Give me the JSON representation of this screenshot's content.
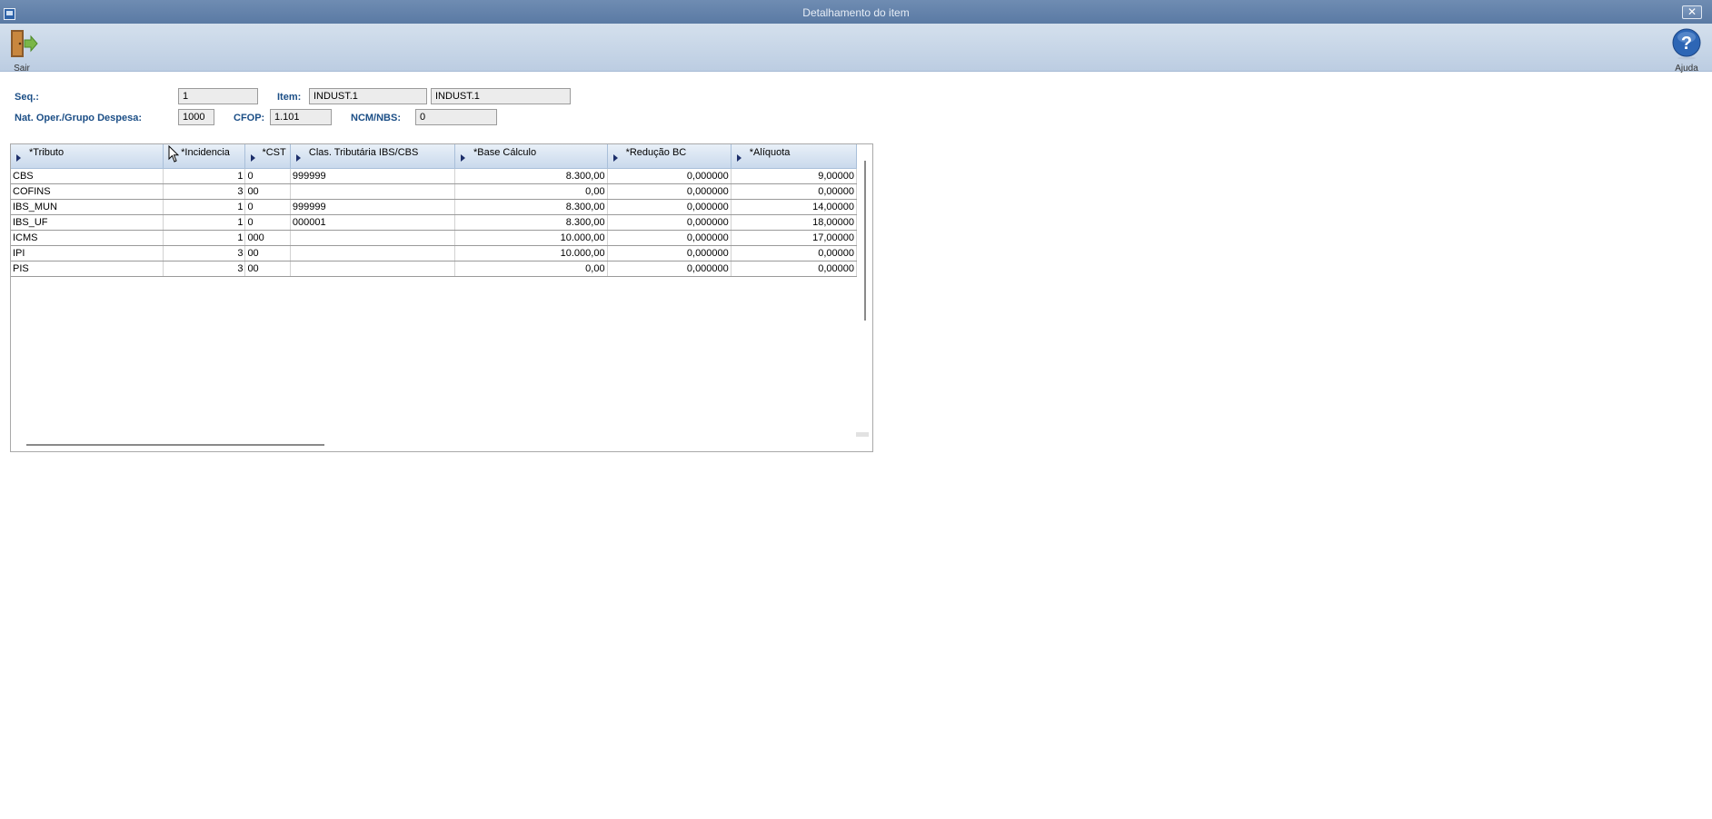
{
  "window": {
    "title": "Detalhamento do item",
    "close_icon": "close-icon"
  },
  "toolbar": {
    "exit": {
      "label": "Sair",
      "icon": "exit-door-icon"
    },
    "help": {
      "label": "Ajuda",
      "icon": "help-icon"
    }
  },
  "form": {
    "seq_label": "Seq.:",
    "seq_value": "1",
    "item_label": "Item:",
    "item_code": "INDUST.1",
    "item_description": "INDUST.1",
    "nat_oper_label": "Nat. Oper./Grupo Despesa:",
    "nat_oper_value": "1000",
    "cfop_label": "CFOP:",
    "cfop_value": "1.101",
    "ncm_label": "NCM/NBS:",
    "ncm_value": "0"
  },
  "grid": {
    "columns": [
      "*Tributo",
      "*Incidencia",
      "*CST",
      "Clas. Tributária IBS/CBS",
      "*Base Cálculo",
      "*Redução BC",
      "*Alíquota"
    ],
    "rows": [
      [
        "CBS",
        "1",
        "0",
        "999999",
        "8.300,00",
        "0,000000",
        "9,00000"
      ],
      [
        "COFINS",
        "3",
        "00",
        "",
        "0,00",
        "0,000000",
        "0,00000"
      ],
      [
        "IBS_MUN",
        "1",
        "0",
        "999999",
        "8.300,00",
        "0,000000",
        "14,00000"
      ],
      [
        "IBS_UF",
        "1",
        "0",
        "000001",
        "8.300,00",
        "0,000000",
        "18,00000"
      ],
      [
        "ICMS",
        "1",
        "000",
        "",
        "10.000,00",
        "0,000000",
        "17,00000"
      ],
      [
        "IPI",
        "3",
        "00",
        "",
        "10.000,00",
        "0,000000",
        "0,00000"
      ],
      [
        "PIS",
        "3",
        "00",
        "",
        "0,00",
        "0,000000",
        "0,00000"
      ]
    ]
  }
}
